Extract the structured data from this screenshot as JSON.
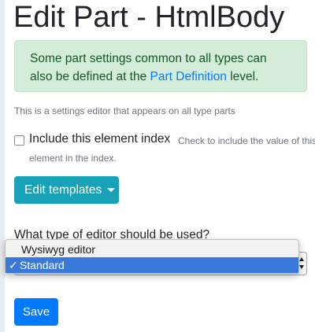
{
  "page": {
    "title": "Edit Part - HtmlBody"
  },
  "alert": {
    "text_before": "Some part settings common to all types can also be defined at the ",
    "link_text": "Part Definition",
    "text_after": " level."
  },
  "description": "This is a settings editor that appears on all type parts",
  "index_checkbox": {
    "label": "Include this element index",
    "help_line1": "Check to include the value of this",
    "help_line2": "element in the index.",
    "checked": false
  },
  "templates_button": {
    "label": "Edit templates",
    "icon": "caret-down-icon"
  },
  "editor_select": {
    "label": "What type of editor should be used?",
    "options": [
      "Wysiwyg editor",
      "Standard"
    ],
    "selected": "Standard",
    "checkmark": "✓"
  },
  "save_button": {
    "label": "Save"
  },
  "colors": {
    "primary": "#007bff",
    "info": "#17a2b8",
    "success_bg": "#d4edda",
    "success_text": "#155724",
    "selection": "#3879d9"
  }
}
